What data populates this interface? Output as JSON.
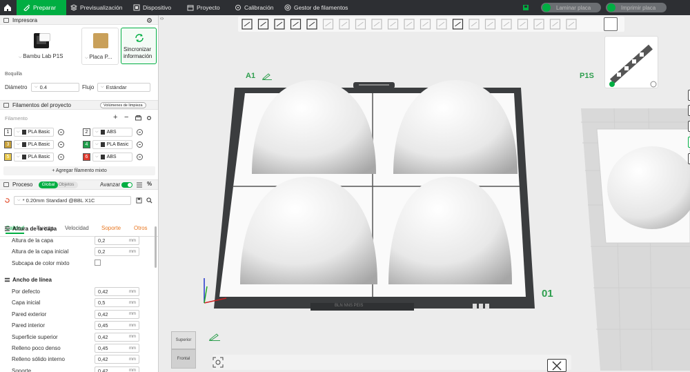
{
  "topbar": {
    "tabs": [
      "Preparar",
      "Previsualización",
      "Dispositivo",
      "Proyecto",
      "Calibración",
      "Gestor de filamentos"
    ],
    "slice_label": "Laminar placa",
    "print_label": "Imprimir placa"
  },
  "printer": {
    "section_title": "Impresora",
    "printer_name": "Bambu Lab P1S",
    "plate_name": "Placa P...",
    "sync_label_1": "Sincronizar",
    "sync_label_2": "información",
    "nozzle_title": "Boquilla",
    "diameter_label": "Diámetro",
    "diameter_value": "0.4",
    "flow_label": "Flujo",
    "flow_value": "Estándar"
  },
  "filaments": {
    "section_title": "Filamentos del proyecto",
    "purge_button": "Volúmenes de limpieza",
    "list_label": "Filamento",
    "items": [
      {
        "num": "1",
        "color": "#ffffff",
        "name": "PLA Basic"
      },
      {
        "num": "2",
        "color": "#ffffff",
        "name": "ABS"
      },
      {
        "num": "3",
        "color": "#c9a23a",
        "name": "PLA Basic"
      },
      {
        "num": "4",
        "color": "#1e9e4a",
        "name": "PLA Basic"
      },
      {
        "num": "5",
        "color": "#e9c84a",
        "name": "PLA Basic"
      },
      {
        "num": "6",
        "color": "#e03a2e",
        "name": "ABS"
      }
    ],
    "add_mixed": "+ Agregar filamento mixto"
  },
  "process": {
    "section_title": "Proceso",
    "global_label": "Global",
    "objects_label": "Objetos",
    "advanced_label": "Avanzar",
    "preset": "* 0.20mm Standard @BBL X1C",
    "tabs": [
      "Calidad",
      "Fuerza",
      "Velocidad",
      "Soporte",
      "Otros"
    ],
    "layer_group": "Altura de la capa",
    "layer_rows": [
      {
        "label": "Altura de la capa",
        "value": "0,2",
        "unit": "mm"
      },
      {
        "label": "Altura de la capa inicial",
        "value": "0,2",
        "unit": "mm"
      }
    ],
    "mixed_color_label": "Subcapa de color mixto",
    "line_group": "Ancho de línea",
    "line_rows": [
      {
        "label": "Por defecto",
        "value": "0,42",
        "unit": "mm"
      },
      {
        "label": "Capa inicial",
        "value": "0,5",
        "unit": "mm"
      },
      {
        "label": "Pared exterior",
        "value": "0,42",
        "unit": "mm"
      },
      {
        "label": "Pared interior",
        "value": "0,45",
        "unit": "mm"
      },
      {
        "label": "Superficie superior",
        "value": "0,42",
        "unit": "mm"
      },
      {
        "label": "Relleno poco denso",
        "value": "0,45",
        "unit": "mm"
      },
      {
        "label": "Relleno sólido interno",
        "value": "0,42",
        "unit": "mm"
      },
      {
        "label": "Soporte",
        "value": "0,42",
        "unit": "mm"
      }
    ]
  },
  "viewport": {
    "plate_a_label": "A1",
    "plate_b_label": "P1S",
    "plate_number": "01",
    "plate_text": "BLN NNS PEIS",
    "view_top": "Superior",
    "view_front": "Frontal",
    "colors": {
      "accent": "#00ae42",
      "topbar": "#2d2f33",
      "bed": "#3a3a3a",
      "canvas": "#ececec"
    }
  }
}
